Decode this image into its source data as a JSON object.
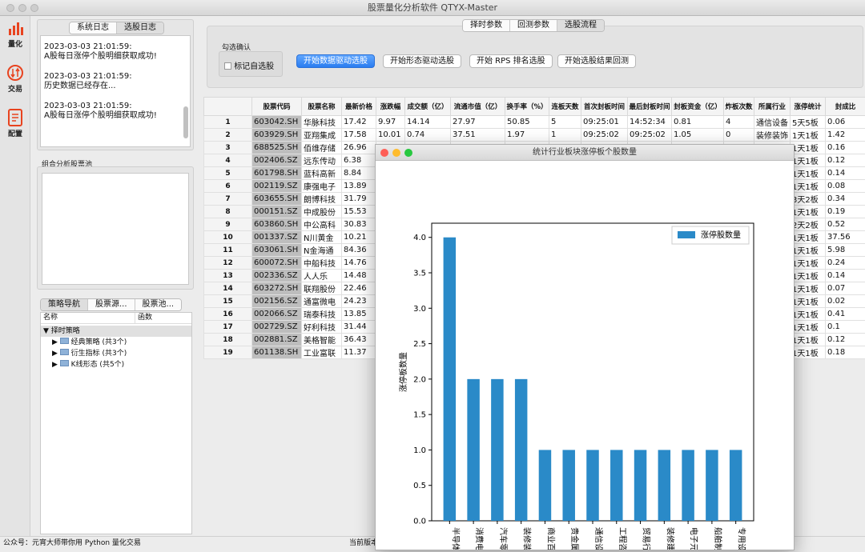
{
  "window": {
    "title": "股票量化分析软件 QTYX-Master"
  },
  "sidebar": {
    "items": [
      {
        "label": "量化",
        "icon": "bar-chart-icon"
      },
      {
        "label": "交易",
        "icon": "trade-arrows-icon"
      },
      {
        "label": "配置",
        "icon": "document-icon"
      }
    ]
  },
  "log": {
    "tabs": [
      "系统日志",
      "选股日志"
    ],
    "entries": [
      {
        "time": "2023-03-03 21:01:59:",
        "text": "A股每日涨停个股明细获取成功!"
      },
      {
        "time": "2023-03-03 21:01:59:",
        "text": "历史数据已经存在..."
      },
      {
        "time": "2023-03-03 21:01:59:",
        "text": "A股每日涨停个股明细获取成功!"
      }
    ]
  },
  "pool": {
    "label": "组合分析股票池"
  },
  "nav": {
    "tabs": [
      "策略导航",
      "股票源...",
      "股票池..."
    ],
    "cols": [
      "名称",
      "函数"
    ],
    "root": "择时策略",
    "children": [
      "经典策略 (共3个)",
      "衍生指标 (共3个)",
      "K线形态 (共5个)"
    ]
  },
  "top": {
    "tabs": [
      "择时参数",
      "回测参数",
      "选股流程"
    ],
    "checkgroup": "勾选确认",
    "checkbox": "标记自选股",
    "buttons": [
      "开始数据驱动选股",
      "开始形态驱动选股",
      "开始 RPS 排名选股",
      "开始选股结果回测"
    ]
  },
  "table": {
    "headers": [
      "股票代码",
      "股票名称",
      "最新价格",
      "涨跌幅",
      "成交额（亿）",
      "流通市值（亿）",
      "换手率（%）",
      "连板天数",
      "首次封板时间",
      "最后封板时间",
      "封板资金（亿）",
      "炸板次数",
      "所属行业",
      "涨停统计",
      "封成比"
    ],
    "rows": [
      [
        "1",
        "603042.SH",
        "华脉科技",
        "17.42",
        "9.97",
        "14.14",
        "27.97",
        "50.85",
        "5",
        "09:25:01",
        "14:52:34",
        "0.81",
        "4",
        "通信设备",
        "5天5板",
        "0.06"
      ],
      [
        "2",
        "603929.SH",
        "亚翔集成",
        "17.58",
        "10.01",
        "0.74",
        "37.51",
        "1.97",
        "1",
        "09:25:02",
        "09:25:02",
        "1.05",
        "0",
        "装修装饰",
        "1天1板",
        "1.42"
      ],
      [
        "3",
        "688525.SH",
        "佰维存储",
        "26.96",
        "",
        "",
        "",
        "",
        "",
        "",
        "",
        "",
        "",
        "",
        "1天1板",
        "0.16"
      ],
      [
        "4",
        "002406.SZ",
        "远东传动",
        "6.38",
        "",
        "",
        "",
        "",
        "",
        "",
        "",
        "",
        "",
        "",
        "1天1板",
        "0.12"
      ],
      [
        "5",
        "601798.SH",
        "蓝科高新",
        "8.84",
        "",
        "",
        "",
        "",
        "",
        "",
        "",
        "",
        "",
        "",
        "1天1板",
        "0.14"
      ],
      [
        "6",
        "002119.SZ",
        "康强电子",
        "13.89",
        "",
        "",
        "",
        "",
        "",
        "",
        "",
        "",
        "",
        "",
        "1天1板",
        "0.08"
      ],
      [
        "7",
        "603655.SH",
        "朗博科技",
        "31.79",
        "",
        "",
        "",
        "",
        "",
        "",
        "",
        "",
        "",
        "",
        "3天2板",
        "0.34"
      ],
      [
        "8",
        "000151.SZ",
        "中成股份",
        "15.53",
        "",
        "",
        "",
        "",
        "",
        "",
        "",
        "",
        "",
        "",
        "1天1板",
        "0.19"
      ],
      [
        "9",
        "603860.SH",
        "中公高科",
        "30.83",
        "",
        "",
        "",
        "",
        "",
        "",
        "",
        "",
        "",
        "",
        "2天2板",
        "0.52"
      ],
      [
        "10",
        "001337.SZ",
        "N川黄金",
        "10.21",
        "",
        "",
        "",
        "",
        "",
        "",
        "",
        "",
        "",
        "",
        "1天1板",
        "37.56"
      ],
      [
        "11",
        "603061.SH",
        "N金海通",
        "84.36",
        "",
        "",
        "",
        "",
        "",
        "",
        "",
        "",
        "",
        "",
        "1天1板",
        "5.98"
      ],
      [
        "12",
        "600072.SH",
        "中船科技",
        "14.76",
        "",
        "",
        "",
        "",
        "",
        "",
        "",
        "",
        "",
        "",
        "1天1板",
        "0.24"
      ],
      [
        "13",
        "002336.SZ",
        "人人乐",
        "14.48",
        "",
        "",
        "",
        "",
        "",
        "",
        "",
        "",
        "",
        "",
        "1天1板",
        "0.14"
      ],
      [
        "14",
        "603272.SH",
        "联翔股份",
        "22.46",
        "",
        "",
        "",
        "",
        "",
        "",
        "",
        "",
        "",
        "",
        "1天1板",
        "0.07"
      ],
      [
        "15",
        "002156.SZ",
        "通富微电",
        "24.23",
        "",
        "",
        "",
        "",
        "",
        "",
        "",
        "",
        "",
        "",
        "1天1板",
        "0.02"
      ],
      [
        "16",
        "002066.SZ",
        "瑞泰科技",
        "13.85",
        "",
        "",
        "",
        "",
        "",
        "",
        "",
        "",
        "",
        "",
        "1天1板",
        "0.41"
      ],
      [
        "17",
        "002729.SZ",
        "好利科技",
        "31.44",
        "",
        "",
        "",
        "",
        "",
        "",
        "",
        "",
        "",
        "",
        "1天1板",
        "0.1"
      ],
      [
        "18",
        "002881.SZ",
        "美格智能",
        "36.43",
        "",
        "",
        "",
        "",
        "",
        "",
        "",
        "",
        "",
        "",
        "1天1板",
        "0.12"
      ],
      [
        "19",
        "601138.SH",
        "工业富联",
        "11.37",
        "",
        "",
        "",
        "",
        "",
        "",
        "",
        "",
        "",
        "",
        "1天1板",
        "0.18"
      ]
    ]
  },
  "status": {
    "left": "公众号：元宵大师带你用 Python 量化交易",
    "middle": "当前版本"
  },
  "chart_window": {
    "title": "统计行业板块涨停板个股数量"
  },
  "chart_data": {
    "type": "bar",
    "title": "",
    "xlabel": "",
    "ylabel": "涨停板数量",
    "categories": [
      "半导体",
      "消费电子",
      "汽车零部",
      "装修装饰",
      "商业百货",
      "贵金属",
      "通信设备",
      "工程咨询",
      "贸易行业",
      "装修建材",
      "电子元件",
      "船舶制造",
      "专用设备"
    ],
    "series": [
      {
        "name": "涨停股数量",
        "values": [
          4,
          2,
          2,
          2,
          1,
          1,
          1,
          1,
          1,
          1,
          1,
          1,
          1
        ]
      }
    ],
    "ylim": [
      0,
      4.2
    ],
    "yticks": [
      "0.0",
      "0.5",
      "1.0",
      "1.5",
      "2.0",
      "2.5",
      "3.0",
      "3.5",
      "4.0"
    ],
    "grid": false,
    "legend": "top-right",
    "color": "#2a8ac8"
  }
}
